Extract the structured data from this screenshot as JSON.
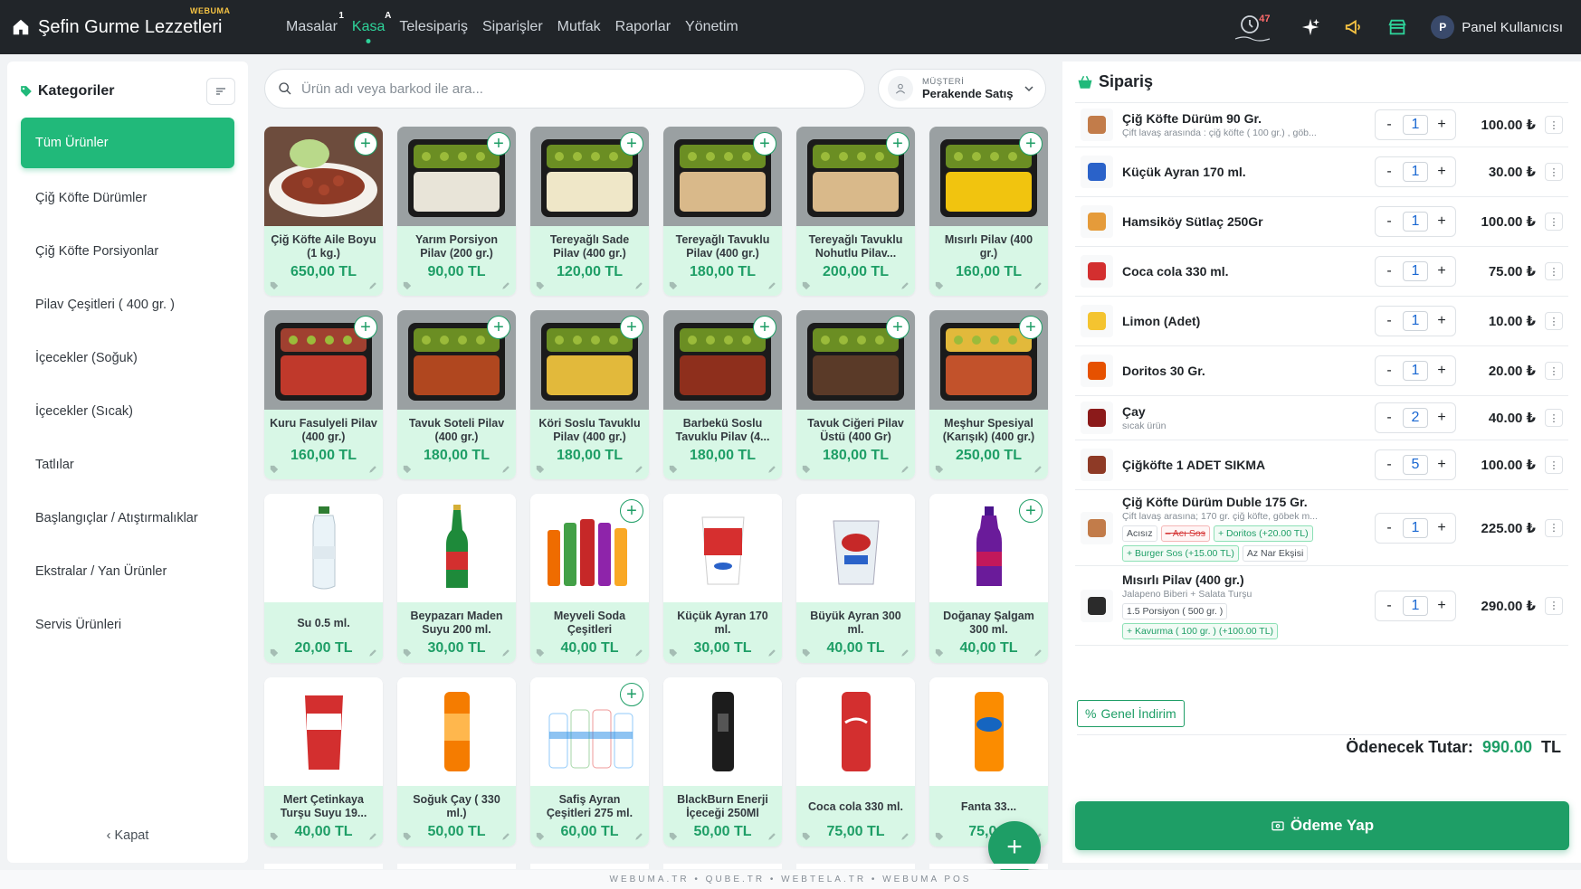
{
  "header": {
    "brand": "Şefin Gurme Lezzetleri",
    "brand_tag": "WEBUMA",
    "nav": [
      {
        "label": "Masalar",
        "badge": "1"
      },
      {
        "label": "Kasa",
        "badge": "A",
        "active": true
      },
      {
        "label": "Telesipariş"
      },
      {
        "label": "Siparişler"
      },
      {
        "label": "Mutfak"
      },
      {
        "label": "Raporlar"
      },
      {
        "label": "Yönetim"
      }
    ],
    "clock_count": "47",
    "user_initial": "P",
    "user_name": "Panel Kullanıcısı",
    "colors": {
      "accent": "#2ed39a",
      "bar": "#212529"
    }
  },
  "sidebar": {
    "title": "Kategoriler",
    "categories": [
      "Tüm Ürünler",
      "Çiğ Köfte Dürümler",
      "Çiğ Köfte Porsiyonlar",
      "Pilav Çeşitleri ( 400 gr. )",
      "İçecekler (Soğuk)",
      "İçecekler (Sıcak)",
      "Tatlılar",
      "Başlangıçlar / Atıştırmalıklar",
      "Ekstralar / Yan Ürünler",
      "Servis Ürünleri"
    ],
    "close_label": "Kapat"
  },
  "search": {
    "placeholder": "Ürün adı veya barkod ile ara..."
  },
  "customer": {
    "label": "MÜŞTERİ",
    "value": "Perakende Satış"
  },
  "products": [
    {
      "name": "Çiğ Köfte Aile Boyu (1 kg.)",
      "price": "650,00 TL"
    },
    {
      "name": "Yarım Porsiyon Pilav (200 gr.)",
      "price": "90,00 TL"
    },
    {
      "name": "Tereyağlı Sade Pilav (400 gr.)",
      "price": "120,00 TL"
    },
    {
      "name": "Tereyağlı Tavuklu Pilav (400 gr.)",
      "price": "180,00 TL"
    },
    {
      "name": "Tereyağlı Tavuklu Nohutlu Pilav...",
      "price": "200,00 TL"
    },
    {
      "name": "Mısırlı Pilav (400 gr.)",
      "price": "160,00 TL"
    },
    {
      "name": "Kuru Fasulyeli Pilav (400 gr.)",
      "price": "160,00 TL"
    },
    {
      "name": "Tavuk Soteli Pilav (400 gr.)",
      "price": "180,00 TL"
    },
    {
      "name": "Köri Soslu Tavuklu Pilav (400 gr.)",
      "price": "180,00 TL"
    },
    {
      "name": "Barbekü Soslu Tavuklu Pilav (4...",
      "price": "180,00 TL"
    },
    {
      "name": "Tavuk Ciğeri Pilav Üstü (400 Gr)",
      "price": "180,00 TL"
    },
    {
      "name": "Meşhur Spesiyal (Karışık) (400 gr.)",
      "price": "250,00 TL"
    },
    {
      "name": "Su 0.5 ml.",
      "price": "20,00 TL"
    },
    {
      "name": "Beypazarı Maden Suyu 200 ml.",
      "price": "30,00 TL"
    },
    {
      "name": "Meyveli Soda Çeşitleri",
      "price": "40,00 TL"
    },
    {
      "name": "Küçük Ayran 170 ml.",
      "price": "30,00 TL"
    },
    {
      "name": "Büyük Ayran 300 ml.",
      "price": "40,00 TL"
    },
    {
      "name": "Doğanay Şalgam 300 ml.",
      "price": "40,00 TL"
    },
    {
      "name": "Mert Çetinkaya Turşu Suyu 19...",
      "price": "40,00 TL"
    },
    {
      "name": "Soğuk Çay ( 330 ml.)",
      "price": "50,00 TL"
    },
    {
      "name": "Safiş Ayran Çeşitleri 275 ml.",
      "price": "60,00 TL"
    },
    {
      "name": "BlackBurn Enerji İçeceği 250Ml",
      "price": "50,00 TL"
    },
    {
      "name": "Coca cola 330 ml.",
      "price": "75,00 TL"
    },
    {
      "name": "Fanta 33...",
      "price": "75,0..."
    }
  ],
  "order": {
    "title": "Sipariş",
    "items": [
      {
        "name": "Çiğ Köfte Dürüm 90 Gr.",
        "desc": "Çift lavaş arasında : çiğ köfte ( 100 gr.) , göb...",
        "qty": "1",
        "price": "100.00 ₺"
      },
      {
        "name": "Küçük Ayran 170 ml.",
        "qty": "1",
        "price": "30.00 ₺"
      },
      {
        "name": "Hamsiköy Sütlaç 250Gr",
        "qty": "1",
        "price": "100.00 ₺"
      },
      {
        "name": "Coca cola 330 ml.",
        "qty": "1",
        "price": "75.00 ₺"
      },
      {
        "name": "Limon (Adet)",
        "qty": "1",
        "price": "10.00 ₺"
      },
      {
        "name": "Doritos 30 Gr.",
        "qty": "1",
        "price": "20.00 ₺"
      },
      {
        "name": "Çay",
        "desc": "sıcak ürün",
        "qty": "2",
        "price": "40.00 ₺"
      },
      {
        "name": "Çiğköfte 1 ADET SIKMA",
        "qty": "5",
        "price": "100.00 ₺"
      },
      {
        "name": "Çiğ Köfte Dürüm Duble 175 Gr.",
        "desc": "Çift lavaş arasına; 170 gr. çiğ köfte, göbek m...",
        "qty": "1",
        "price": "225.00 ₺",
        "chips": [
          {
            "text": "Acısız",
            "kind": "plain"
          },
          {
            "text": "– Acı Sos",
            "kind": "rem"
          },
          {
            "text": "+ Doritos (+20.00 TL)",
            "kind": "add"
          },
          {
            "text": "+ Burger Sos (+15.00 TL)",
            "kind": "add"
          },
          {
            "text": "Az Nar Ekşisi",
            "kind": "plain"
          }
        ]
      },
      {
        "name": "Mısırlı Pilav (400 gr.)",
        "desc": "Jalapeno Biberi + Salata Turşu",
        "qty": "1",
        "price": "290.00 ₺",
        "chips": [
          {
            "text": "1.5 Porsiyon ( 500 gr. )",
            "kind": "plain"
          },
          {
            "text": "+ Kavurma ( 100 gr. ) (+100.00 TL)",
            "kind": "add"
          }
        ]
      }
    ],
    "discount_label": "Genel İndirim",
    "total_label": "Ödenecek Tutar:",
    "total_amount": "990.00",
    "total_currency": "TL",
    "pay_label": "Ödeme Yap"
  },
  "footer": "WEBUMA.TR • QUBE.TR • WEBTELA.TR • WEBUMA POS"
}
